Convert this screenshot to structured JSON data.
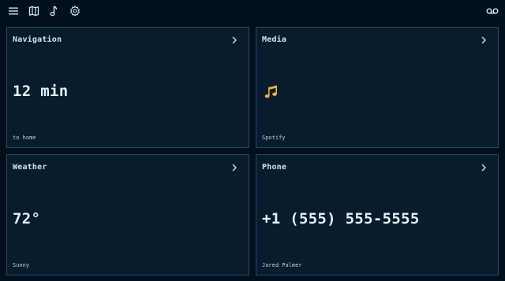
{
  "topbar": {
    "icons": [
      "menu-icon",
      "map-icon",
      "music-note-icon",
      "settings-gear-icon",
      "voicemail-icon"
    ]
  },
  "cards": {
    "navigation": {
      "title": "Navigation",
      "value": "12 min",
      "sub": "to home"
    },
    "media": {
      "title": "Media",
      "icon": "music-notes-icon",
      "sub": "Spotify"
    },
    "weather": {
      "title": "Weather",
      "value": "72°",
      "sub": "Sunny"
    },
    "phone": {
      "title": "Phone",
      "value": "+1 (555) 555-5555",
      "sub": "Jared Palmer"
    }
  },
  "colors": {
    "background": "#02101e",
    "card": "#081c2e",
    "border": "#2a4a63",
    "text": "#dbe9f3",
    "accent": "#f0b23c"
  }
}
